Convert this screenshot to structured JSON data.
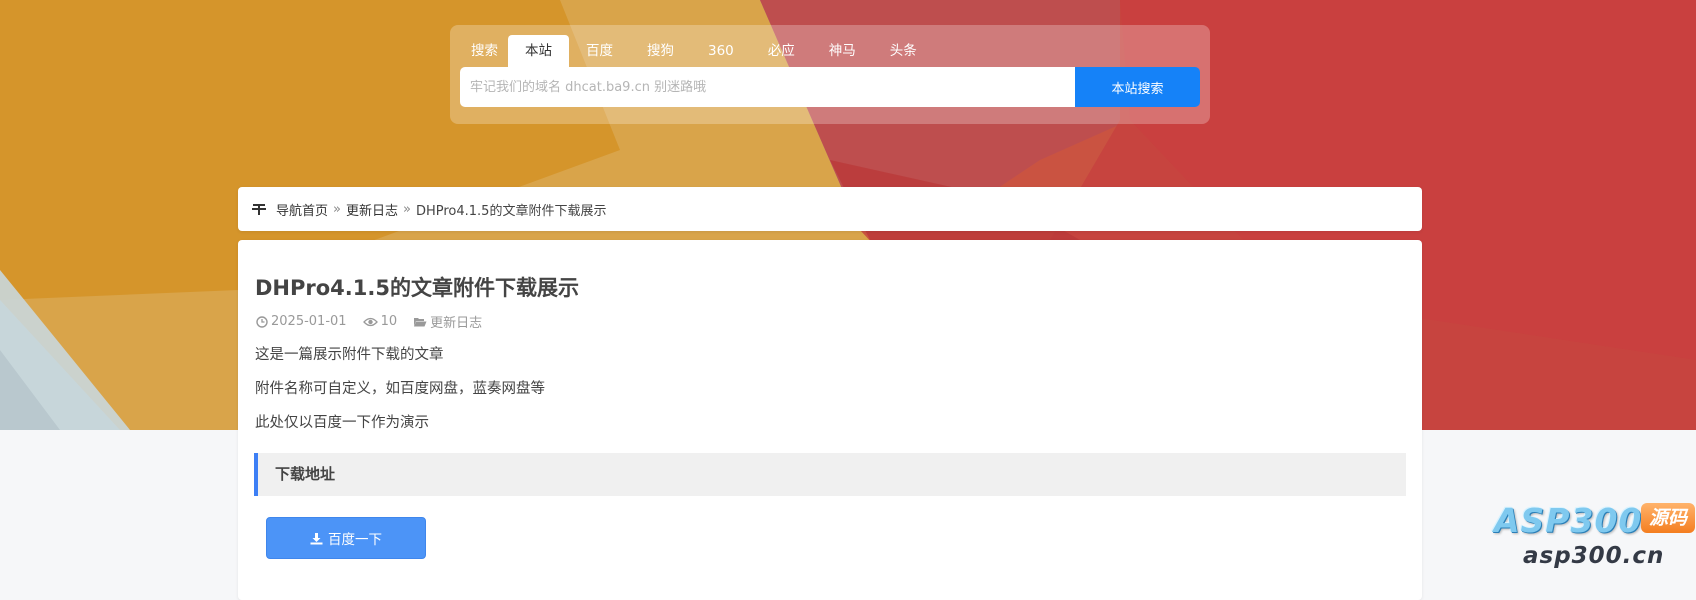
{
  "search": {
    "label": "搜索",
    "tabs": [
      "本站",
      "百度",
      "搜狗",
      "360",
      "必应",
      "神马",
      "头条"
    ],
    "active_tab": "本站",
    "placeholder": "牢记我们的域名 dhcat.ba9.cn 别迷路哦",
    "button_label": "本站搜索"
  },
  "breadcrumb": {
    "icon": "nav-menu-icon",
    "home": "导航首页",
    "separator": "»",
    "category": "更新日志",
    "current": "DHPro4.1.5的文章附件下载展示"
  },
  "article": {
    "title": "DHPro4.1.5的文章附件下载展示",
    "meta": {
      "date": "2025-01-01",
      "views": "10",
      "category": "更新日志"
    },
    "paragraphs": [
      "这是一篇展示附件下载的文章",
      "附件名称可自定义，如百度网盘，蓝奏网盘等",
      "此处仅以百度一下作为演示"
    ],
    "download_section_title": "下载地址",
    "download_button_label": "百度一下"
  },
  "watermark": {
    "brand": "ASP300",
    "tag": "源码",
    "domain": "asp300.cn"
  },
  "colors": {
    "accent": "#1582f8",
    "download_button": "#4c94f7",
    "section_border": "#3d7ff5"
  }
}
